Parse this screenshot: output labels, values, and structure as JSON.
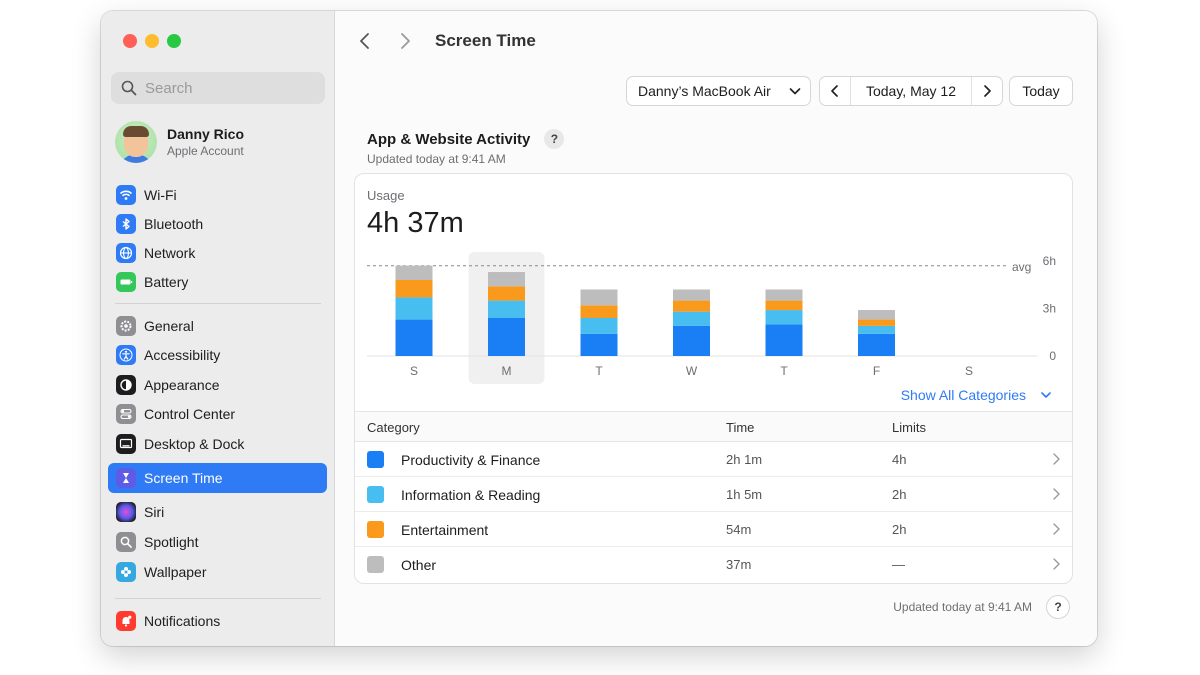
{
  "sidebar": {
    "search_placeholder": "Search",
    "account": {
      "name": "Danny Rico",
      "subtitle": "Apple Account"
    },
    "items": [
      {
        "label": "Wi-Fi",
        "icon": "wifi-icon",
        "color": "#2f7bf6"
      },
      {
        "label": "Bluetooth",
        "icon": "bluetooth-icon",
        "color": "#2f7bf6"
      },
      {
        "label": "Network",
        "icon": "globe-icon",
        "color": "#2f7bf6"
      },
      {
        "label": "Battery",
        "icon": "battery-icon",
        "color": "#34c759"
      },
      {
        "label": "General",
        "icon": "gear-icon",
        "color": "#8e8e93"
      },
      {
        "label": "Accessibility",
        "icon": "accessibility-icon",
        "color": "#2f7bf6"
      },
      {
        "label": "Appearance",
        "icon": "appearance-icon",
        "color": "#1d1d1f"
      },
      {
        "label": "Control Center",
        "icon": "control-center-icon",
        "color": "#8e8e93"
      },
      {
        "label": "Desktop & Dock",
        "icon": "desktop-icon",
        "color": "#1d1d1f"
      },
      {
        "label": "Screen Time",
        "icon": "hourglass-icon",
        "color": "#5e5ce6",
        "active": true
      },
      {
        "label": "Siri",
        "icon": "siri-icon",
        "color": "#1d1d1f"
      },
      {
        "label": "Spotlight",
        "icon": "magnifier-icon",
        "color": "#8e8e93"
      },
      {
        "label": "Wallpaper",
        "icon": "flower-icon",
        "color": "#36a8e0"
      },
      {
        "label": "Notifications",
        "icon": "bell-icon",
        "color": "#ff3b30"
      }
    ]
  },
  "header": {
    "title": "Screen Time",
    "device": "Danny’s MacBook Air",
    "date": "Today, May 12",
    "today_button": "Today"
  },
  "activity": {
    "title": "App & Website Activity",
    "help": "?",
    "updated": "Updated today at 9:41 AM",
    "usage_label": "Usage",
    "usage_value": "4h 37m",
    "show_all": "Show All Categories"
  },
  "chart_data": {
    "type": "bar",
    "stacked": true,
    "categories": [
      "S",
      "M",
      "T",
      "W",
      "T",
      "F",
      "S"
    ],
    "series": [
      {
        "name": "Productivity & Finance",
        "color": "#1a7ef5",
        "values": [
          2.3,
          2.4,
          1.4,
          1.9,
          2.0,
          1.4,
          0
        ]
      },
      {
        "name": "Information & Reading",
        "color": "#48bdf0",
        "values": [
          1.4,
          1.1,
          1.0,
          0.9,
          0.9,
          0.5,
          0
        ]
      },
      {
        "name": "Entertainment",
        "color": "#f99a1c",
        "values": [
          1.1,
          0.9,
          0.8,
          0.7,
          0.6,
          0.4,
          0
        ]
      },
      {
        "name": "Other",
        "color": "#bdbdbd",
        "values": [
          0.9,
          0.9,
          1.0,
          0.7,
          0.7,
          0.6,
          0
        ]
      }
    ],
    "yticks": [
      "0",
      "3h",
      "6h"
    ],
    "ylim": [
      0,
      6
    ],
    "avg_label": "avg",
    "avg_value": 5.7,
    "selected_index": 1
  },
  "table": {
    "headers": {
      "category": "Category",
      "time": "Time",
      "limits": "Limits"
    },
    "rows": [
      {
        "category": "Productivity & Finance",
        "time": "2h 1m",
        "limit": "4h",
        "color": "#1a7ef5"
      },
      {
        "category": "Information & Reading",
        "time": "1h 5m",
        "limit": "2h",
        "color": "#48bdf0"
      },
      {
        "category": "Entertainment",
        "time": "54m",
        "limit": "2h",
        "color": "#f99a1c"
      },
      {
        "category": "Other",
        "time": "37m",
        "limit": "—",
        "color": "#bdbdbd"
      }
    ]
  },
  "footer": {
    "updated": "Updated today at 9:41 AM",
    "help": "?"
  }
}
